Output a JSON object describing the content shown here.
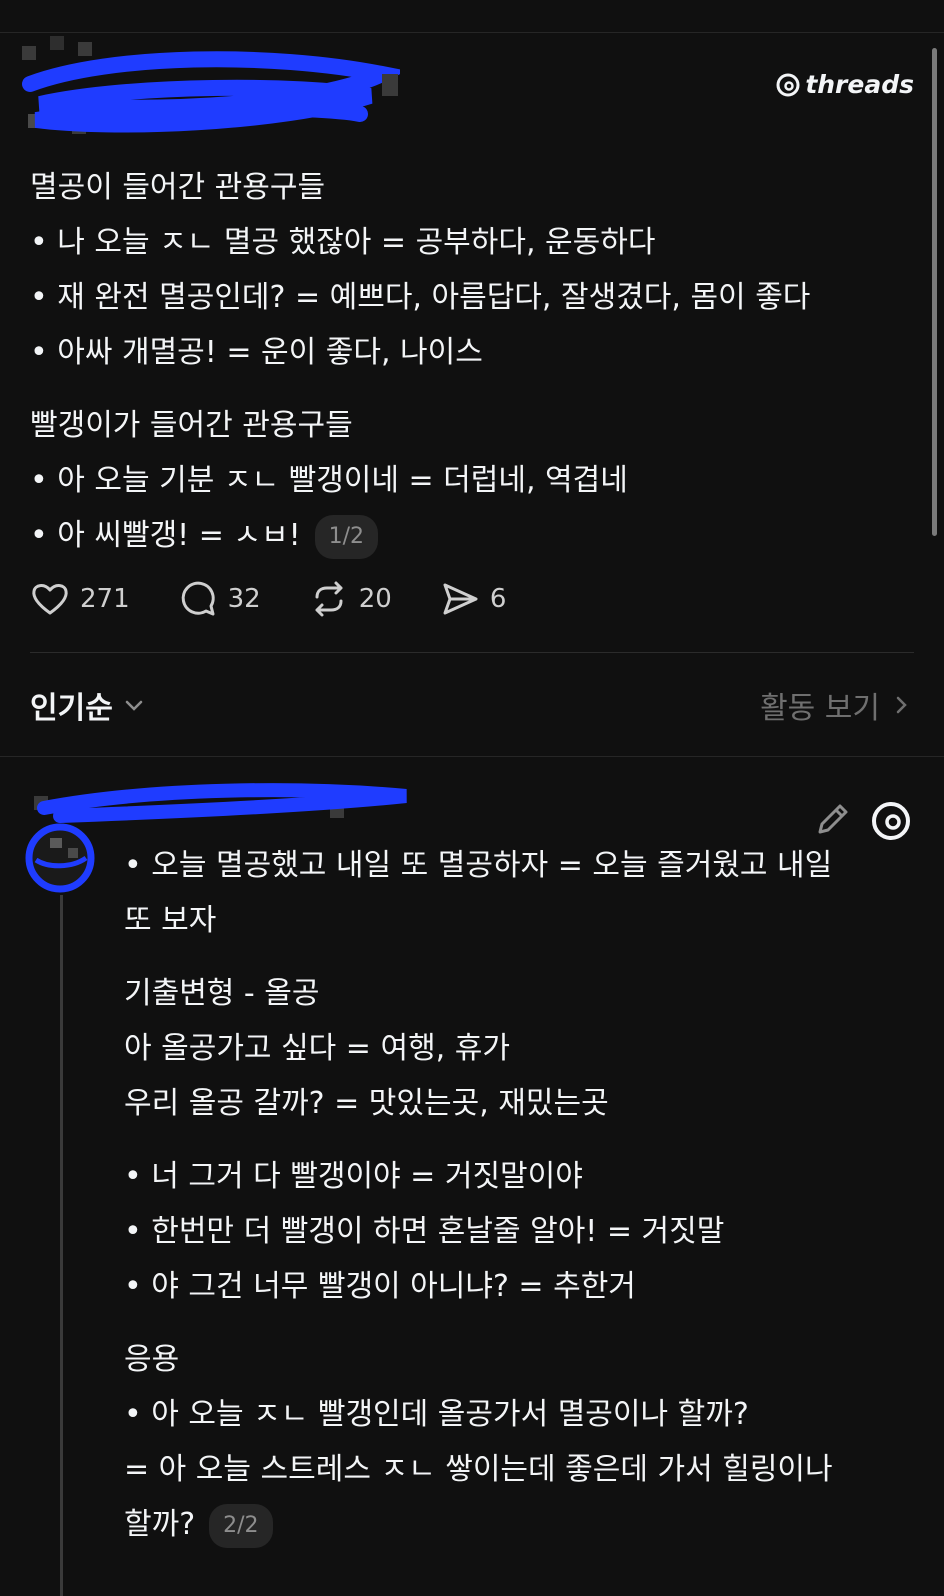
{
  "brand": {
    "name": "threads"
  },
  "post": {
    "section1_title": "멸공이 들어간 관용구들",
    "section1_items": [
      "• 나 오늘 ㅈㄴ 멸공 했잖아 = 공부하다, 운동하다",
      "• 재 완전 멸공인데? = 예쁘다, 아름답다, 잘생겼다, 몸이 좋다",
      "• 아싸 개멸공! = 운이 좋다, 나이스"
    ],
    "section2_title": "빨갱이가 들어간 관용구들",
    "section2_items": [
      "• 아 오늘 기분 ㅈㄴ 빨갱이네 = 더럽네, 역겹네",
      "• 아 씨빨갱! = ㅅㅂ!"
    ],
    "page_badge": "1/2"
  },
  "actions": {
    "likes": "271",
    "comments": "32",
    "reposts": "20",
    "shares": "6"
  },
  "sort": {
    "label": "인기순",
    "activity_link": "활동 보기"
  },
  "reply": {
    "intro_line1": "• 오늘 멸공했고 내일 또 멸공하자 = 오늘 즐거웠고 내일",
    "intro_line2": "또 보자",
    "block1": [
      "기출변형 - 올공",
      "아 올공가고 싶다 = 여행, 휴가",
      "우리 올공 갈까? = 맛있는곳, 재밌는곳"
    ],
    "block2": [
      "• 너 그거 다 빨갱이야 = 거짓말이야",
      "• 한번만 더 빨갱이 하면 혼날줄 알아! = 거짓말",
      "• 야 그건 너무 빨갱이 아니냐? = 추한거"
    ],
    "block3_title": "응용",
    "block3_line1": "• 아 오늘 ㅈㄴ 빨갱인데 올공가서 멸공이나 할까?",
    "block3_line2": "= 아 오늘 스트레스 ㅈㄴ 쌓이는데 좋은데 가서 힐링이나",
    "block3_line3": "할까?",
    "page_badge": "2/2"
  },
  "colors": {
    "background": "#101010",
    "text": "#f3f5f7",
    "muted": "#6f6f6f",
    "scribble": "#1f3cff"
  }
}
